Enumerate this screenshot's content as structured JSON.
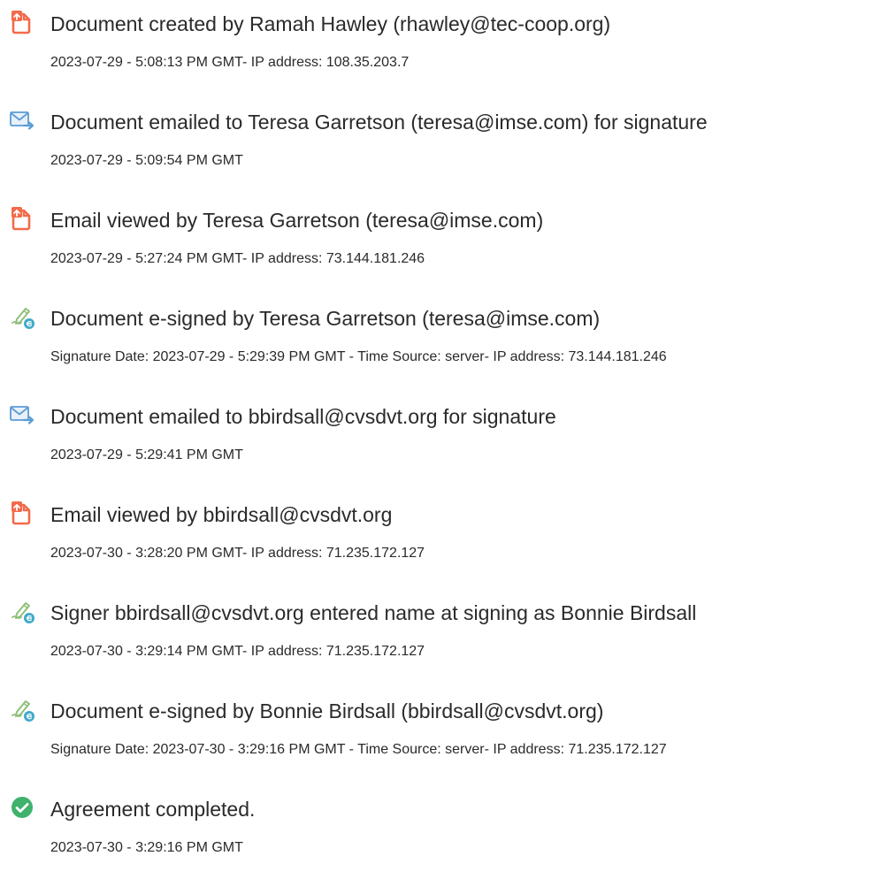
{
  "events": [
    {
      "icon": "document-icon",
      "title": "Document created by Ramah Hawley (rhawley@tec-coop.org)",
      "detail": "2023-07-29 - 5:08:13 PM GMT- IP address: 108.35.203.7"
    },
    {
      "icon": "email-sent-icon",
      "title": "Document emailed to Teresa Garretson (teresa@imse.com) for signature",
      "detail": "2023-07-29 - 5:09:54 PM GMT"
    },
    {
      "icon": "document-icon",
      "title": "Email viewed by Teresa Garretson (teresa@imse.com)",
      "detail": "2023-07-29 - 5:27:24 PM GMT- IP address: 73.144.181.246"
    },
    {
      "icon": "esign-pen-icon",
      "title": "Document e-signed by Teresa Garretson (teresa@imse.com)",
      "detail": "Signature Date: 2023-07-29 - 5:29:39 PM GMT - Time Source: server- IP address: 73.144.181.246"
    },
    {
      "icon": "email-sent-icon",
      "title": "Document emailed to bbirdsall@cvsdvt.org for signature",
      "detail": "2023-07-29 - 5:29:41 PM GMT"
    },
    {
      "icon": "document-icon",
      "title": "Email viewed by bbirdsall@cvsdvt.org",
      "detail": "2023-07-30 - 3:28:20 PM GMT- IP address: 71.235.172.127"
    },
    {
      "icon": "esign-pen-icon",
      "title": "Signer bbirdsall@cvsdvt.org entered name at signing as Bonnie Birdsall",
      "detail": "2023-07-30 - 3:29:14 PM GMT- IP address: 71.235.172.127"
    },
    {
      "icon": "esign-pen-icon",
      "title": "Document e-signed by Bonnie Birdsall (bbirdsall@cvsdvt.org)",
      "detail": "Signature Date: 2023-07-30 - 3:29:16 PM GMT - Time Source: server- IP address: 71.235.172.127"
    },
    {
      "icon": "check-circle-icon",
      "title": "Agreement completed.",
      "detail": "2023-07-30 - 3:29:16 PM GMT"
    }
  ],
  "colors": {
    "document_icon": "#f26b4a",
    "email_icon": "#5b9bd5",
    "pen_icon": "#8fbf7a",
    "pen_badge": "#3fa9c9",
    "check_icon": "#3fb26b",
    "text": "#2a2a2a"
  }
}
